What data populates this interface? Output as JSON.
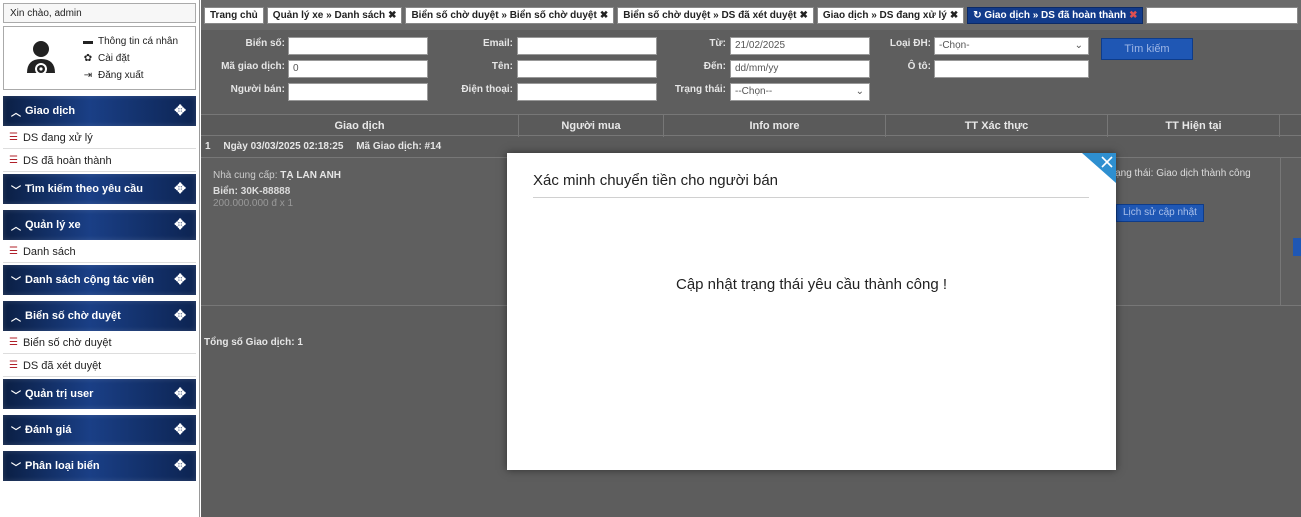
{
  "sidebar": {
    "greeting": "Xin chào, admin",
    "profile_links": [
      {
        "icon": "chat-icon",
        "glyph": "▬",
        "label": "Thông tin cá nhân"
      },
      {
        "icon": "gear-icon",
        "glyph": "✿",
        "label": "Cài đặt"
      },
      {
        "icon": "logout-icon",
        "glyph": "⇥",
        "label": "Đăng xuất"
      }
    ],
    "sections": [
      {
        "label": "Giao dịch",
        "open": true,
        "items": [
          "DS đang xử lý",
          "DS đã hoàn thành"
        ]
      },
      {
        "label": "Tìm kiếm theo yêu cầu",
        "open": false,
        "items": []
      },
      {
        "label": "Quản lý xe",
        "open": true,
        "items": [
          "Danh sách"
        ]
      },
      {
        "label": "Danh sách cộng tác viên",
        "open": false,
        "items": []
      },
      {
        "label": "Biển số chờ duyệt",
        "open": true,
        "items": [
          "Biển số chờ duyệt",
          "DS đã xét duyệt"
        ]
      },
      {
        "label": "Quản trị user",
        "open": false,
        "items": []
      },
      {
        "label": "Đánh giá",
        "open": false,
        "items": []
      },
      {
        "label": "Phân loại biển",
        "open": false,
        "items": []
      }
    ]
  },
  "tabs": [
    {
      "label": "Trang chủ",
      "closable": false
    },
    {
      "label": "Quản lý xe » Danh sách",
      "closable": true
    },
    {
      "label": "Biển số chờ duyệt » Biển số chờ duyệt",
      "closable": true
    },
    {
      "label": "Biển số chờ duyệt » DS đã xét duyệt",
      "closable": true
    },
    {
      "label": "Giao dịch » DS đang xử lý",
      "closable": true
    },
    {
      "label": "Giao dịch » DS đã hoàn thành",
      "closable": true,
      "active": true
    }
  ],
  "search": {
    "bien_so_label": "Biển số:",
    "bien_so_value": "",
    "email_label": "Email:",
    "email_value": "",
    "tu_label": "Từ:",
    "tu_value": "21/02/2025",
    "loai_dh_label": "Loại ĐH:",
    "loai_dh_value": "-Chọn-",
    "ma_gd_label": "Mã giao dịch:",
    "ma_gd_value": "0",
    "ten_label": "Tên:",
    "ten_value": "",
    "den_label": "Đến:",
    "den_value": "dd/mm/yy",
    "o_to_label": "Ô tô:",
    "o_to_value": "",
    "nguoi_ban_label": "Người bán:",
    "nguoi_ban_value": "",
    "dien_thoai_label": "Điện thoại:",
    "dien_thoai_value": "",
    "trang_thai_label": "Trạng thái:",
    "trang_thai_value": "--Chọn--",
    "button": "Tìm kiếm"
  },
  "table": {
    "headers": [
      "Giao dịch",
      "Người mua",
      "Info more",
      "TT Xác thực",
      "TT Hiện tại"
    ],
    "row": {
      "index": "1",
      "date": "Ngày 03/03/2025 02:18:25",
      "code": "Mã Giao dịch: #14",
      "supplier_label": "Nhà cung cấp:",
      "supplier": "TẠ LAN ANH",
      "plate": "Biển: 30K-88888",
      "price": "200.000.000 đ x 1",
      "status": "Trạng thái: Giao dịch thành công",
      "history_button": "Lịch sử cập nhật"
    },
    "total_label": "Tổng số Giao dịch:",
    "total_value": "1"
  },
  "modal": {
    "title": "Xác minh chuyển tiền cho người bán",
    "message": "Cập nhật trạng thái yêu cầu thành công !"
  },
  "colors": {
    "menu_head": "#0b1f44",
    "accent": "#1f57b4",
    "close_corner": "#2e8fd0"
  }
}
